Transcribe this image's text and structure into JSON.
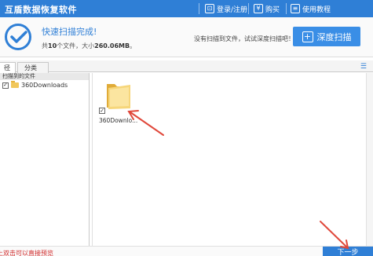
{
  "titlebar": {
    "title": "互盾数据恢复软件",
    "login_label": "登录/注册",
    "buy_label": "购买",
    "tutorial_label": "使用教程"
  },
  "status": {
    "headline": "快速扫描完成!",
    "summary_prefix": "共",
    "file_count": "10",
    "summary_mid": "个文件，大小",
    "size": "260.06MB",
    "summary_suffix": "。",
    "hint": "没有扫描到文件，试试深度扫描吧！",
    "deep_scan_label": "深度扫描"
  },
  "tabs": [
    {
      "label": "径"
    },
    {
      "label": "分类"
    }
  ],
  "tree": {
    "root_label": "扫描到的文件",
    "nodes": [
      {
        "label": "360Downloads",
        "checked": true
      }
    ]
  },
  "files": [
    {
      "name": "360Downlo...",
      "checked": true
    }
  ],
  "bottom": {
    "tip": "上双击可以直接预览",
    "next_label": "下一步"
  },
  "colors": {
    "accent": "#2f7fd6",
    "tip": "#d12a2a",
    "arrow": "#e0483b"
  }
}
